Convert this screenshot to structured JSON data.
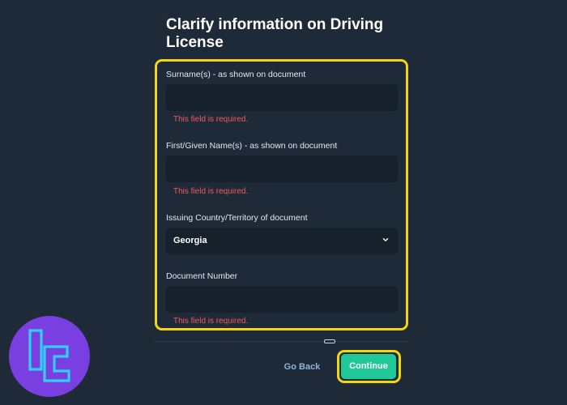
{
  "page": {
    "title": "Clarify information on Driving License"
  },
  "form": {
    "surname": {
      "label": "Surname(s) - as shown on document",
      "value": "",
      "error": "This field is required."
    },
    "given_name": {
      "label": "First/Given Name(s) - as shown on document",
      "value": "",
      "error": "This field is required."
    },
    "country": {
      "label": "Issuing Country/Territory of document",
      "value": "Georgia"
    },
    "document_number": {
      "label": "Document Number",
      "value": "",
      "error": "This field is required."
    }
  },
  "actions": {
    "back_label": "Go Back",
    "continue_label": "Continue"
  },
  "colors": {
    "highlight": "#f5d50c",
    "accent": "#20c997",
    "error": "#ef5b5b",
    "logo": "#7a3fe0"
  },
  "icons": {
    "select_chevron": "chevron-down-icon",
    "logo": "brand-logo-icon"
  }
}
